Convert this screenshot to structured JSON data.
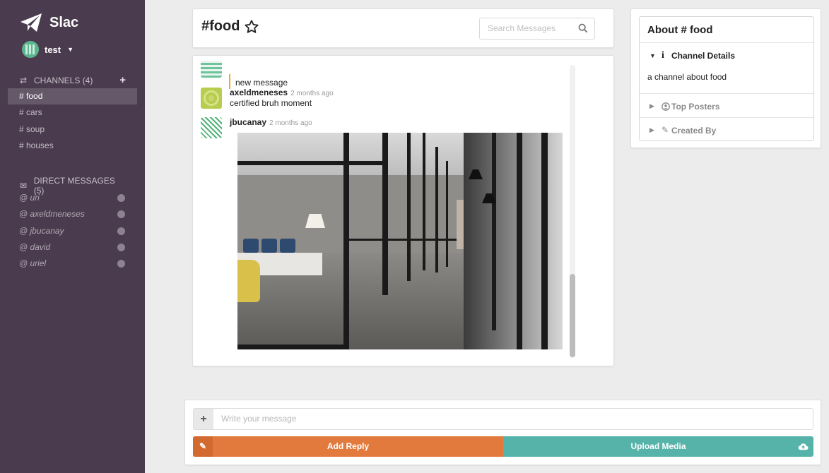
{
  "app": {
    "name": "Slac",
    "user": "test"
  },
  "sidebar": {
    "channels_header": "CHANNELS (4)",
    "channels": [
      "# food",
      "# cars",
      "# soup",
      "# houses"
    ],
    "dm_header": "DIRECT MESSAGES (5)",
    "dms": [
      "@ uri",
      "@ axeldmeneses",
      "@ jbucanay",
      "@ david",
      "@ uriel"
    ]
  },
  "header": {
    "title": "#food",
    "search_placeholder": "Search Messages"
  },
  "messages": [
    {
      "author": "",
      "time": "",
      "text": "new message"
    },
    {
      "author": "axeldmeneses",
      "time": "2 months ago",
      "text": "certified bruh moment"
    },
    {
      "author": "jbucanay",
      "time": "2 months ago",
      "text": ""
    }
  ],
  "about": {
    "title": "About # food",
    "channel_details_label": "Channel Details",
    "channel_description": "a channel about food",
    "top_posters_label": "Top Posters",
    "created_by_label": "Created By"
  },
  "composer": {
    "placeholder": "Write your message",
    "reply_label": "Add Reply",
    "upload_label": "Upload Media"
  },
  "colors": {
    "sidebar_bg": "#4a3c4e",
    "reply_button": "#e27a3d",
    "upload_button": "#55b3aa",
    "quote_bar": "#f0a830"
  }
}
